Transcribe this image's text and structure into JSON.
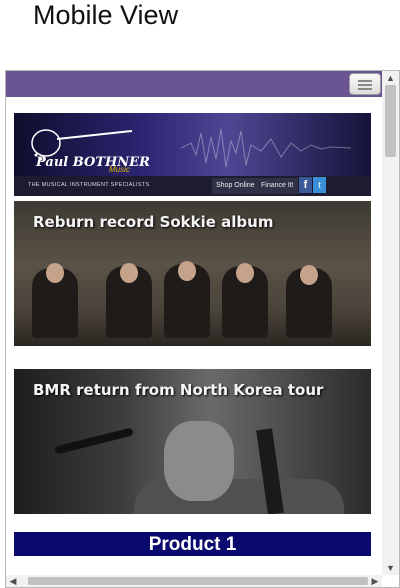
{
  "caption": "Mobile View",
  "header": {
    "brand": "Paul BOTHNER",
    "brand_sub": "Music",
    "tagline": "THE MUSICAL INSTRUMENT SPECIALISTS",
    "nav": [
      "Shop Online",
      "Finance It!"
    ],
    "social": [
      "facebook-icon",
      "twitter-icon"
    ]
  },
  "news": [
    {
      "title": "Reburn record Sokkie album"
    },
    {
      "title": "BMR return from North Korea tour"
    }
  ],
  "product": {
    "title": "Product 1"
  },
  "colors": {
    "topbar": "#6a5494",
    "product_bar": "#0a0a6e"
  }
}
